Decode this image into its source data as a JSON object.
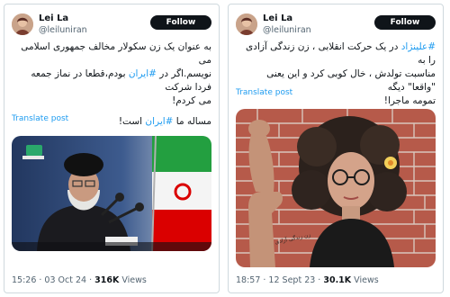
{
  "left": {
    "name": "Lei La",
    "handle": "@leiluniran",
    "follow": "Follow",
    "line1": "به عنوان یک زن سکولار مخالف جمهوری اسلامی می",
    "line2_pre": "نویسم.اگر در ",
    "line2_tag": "#ایران",
    "line2_post": " بودم،قطعا در نماز جمعه فردا شرکت",
    "line3": "می کردم!",
    "line4_pre": "مساله ما ",
    "line4_tag": "#ایران",
    "line4_post": " است!",
    "translate": "Translate post",
    "time": "15:26 · 03 Oct 24 · ",
    "views_count": "316K",
    "views_label": " Views"
  },
  "right": {
    "name": "Lei La",
    "handle": "@leiluniran",
    "follow": "Follow",
    "line1_tag": "#علینژاد",
    "line1_post": " در یک حرکت انقلابی ، زن زندگی آزادی را به",
    "line2": "مناسبت تولدش ، خال کوبی کرد و این یعنی \"واقعا\" دیگه",
    "line3": "تمومه ماجرا!",
    "translate": "Translate post",
    "tattoo_text": "زن زندگی آزادی",
    "time": "18:57 · 12 Sept 23 · ",
    "views_count": "30.1K",
    "views_label": " Views"
  },
  "colors": {
    "accent": "#1d9bf0",
    "text": "#0f1419",
    "muted": "#536471",
    "border": "#cfd9de"
  }
}
